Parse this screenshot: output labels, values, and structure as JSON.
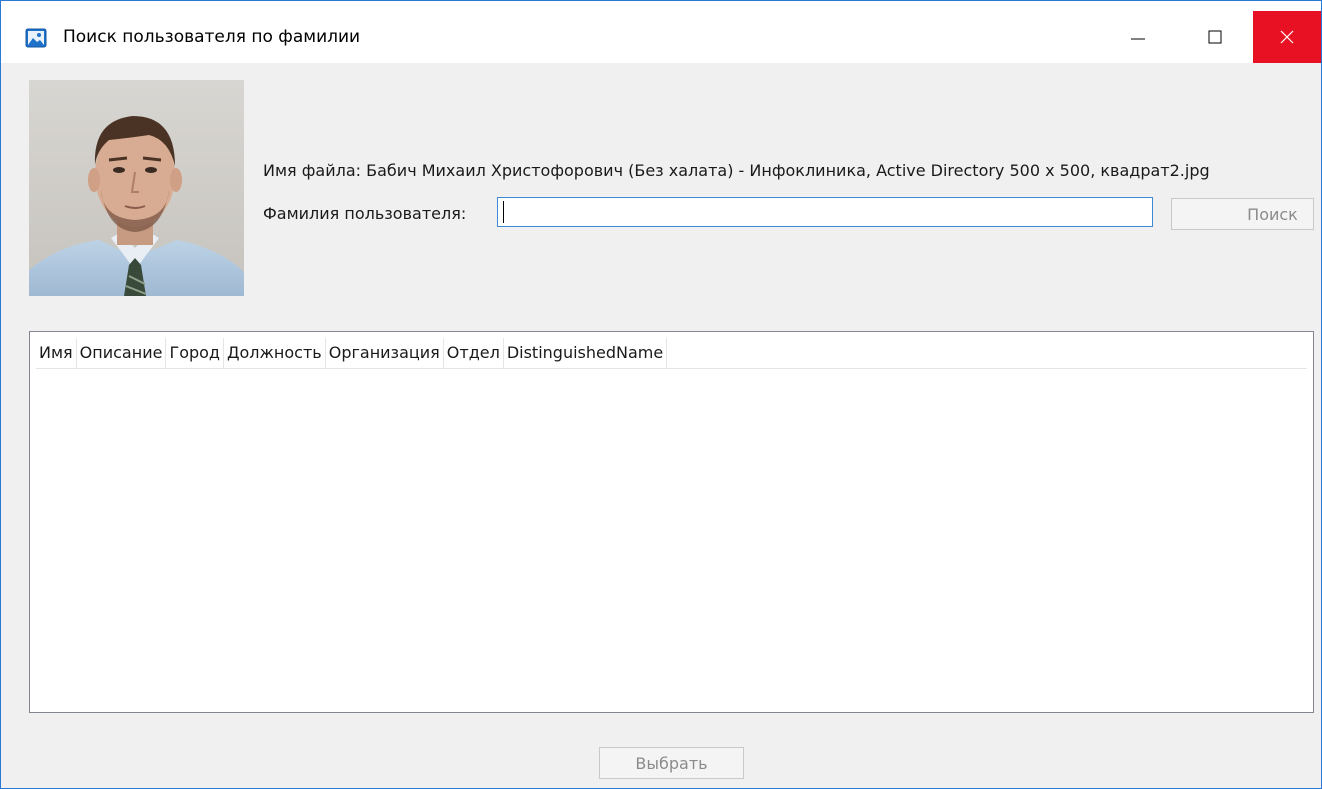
{
  "window": {
    "title": "Поиск пользователя по фамилии",
    "controls": {
      "minimize": "—",
      "maximize": "☐",
      "close": "✕"
    },
    "close_color": "#e81123",
    "border_color": "#2b79d7"
  },
  "photo": {
    "icon": "user-photo"
  },
  "file": {
    "label": "Имя файла: Бабич Михаил Христофорович (Без халата) - Инфоклиника, Active Directory 500 x 500, квадрат2.jpg"
  },
  "search": {
    "label": "Фамилия пользователя:",
    "value": "",
    "button_label": "Поиск"
  },
  "results": {
    "columns": [
      "Имя",
      "Описание",
      "Город",
      "Должность",
      "Организация",
      "Отдел",
      "DistinguishedName"
    ],
    "rows": []
  },
  "footer": {
    "select_label": "Выбрать"
  }
}
